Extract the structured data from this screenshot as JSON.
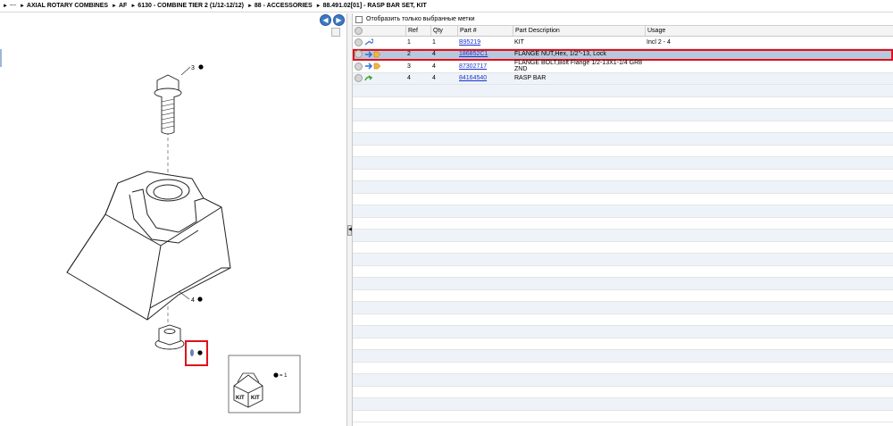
{
  "breadcrumb": [
    {
      "label": "---"
    },
    {
      "label": "AXIAL ROTARY COMBINES"
    },
    {
      "label": "AF"
    },
    {
      "label": "6130 - COMBINE TIER 2 (1/12-12/12)"
    },
    {
      "label": "88 - ACCESSORIES"
    },
    {
      "label": "88.491.02[01] - RASP BAR SET, KIT"
    }
  ],
  "nav": {
    "back": "◀",
    "forward": "▶"
  },
  "diagram": {
    "callout_3": "3",
    "callout_4": "4",
    "kit_legend": "= 1",
    "kit_label_1": "KIT",
    "kit_label_2": "KIT"
  },
  "filter": {
    "label": "Отобразить только выбранные метки"
  },
  "table": {
    "headers": {
      "ref": "Ref",
      "qty": "Qty",
      "part": "Part #",
      "desc": "Part Description",
      "usage": "Usage"
    },
    "rows": [
      {
        "ref": "1",
        "qty": "1",
        "part": "B95219",
        "desc": "KIT",
        "usage": "Incl  2 - 4",
        "icon": "wrench-icon"
      },
      {
        "ref": "2",
        "qty": "4",
        "part": "186852C1",
        "desc": "FLANGE NUT,Hex, 1/2\"-13, Lock",
        "usage": "",
        "icon": "arrow-tag-icon"
      },
      {
        "ref": "3",
        "qty": "4",
        "part": "87302717",
        "desc": "FLANGE BOLT,Bolt Flange 1/2-13X1-1/4 GR8 ZND",
        "usage": "",
        "icon": "arrow-tag-icon"
      },
      {
        "ref": "4",
        "qty": "4",
        "part": "84164540",
        "desc": "RASP BAR",
        "usage": "",
        "icon": "recycle-arrow-icon"
      }
    ]
  }
}
